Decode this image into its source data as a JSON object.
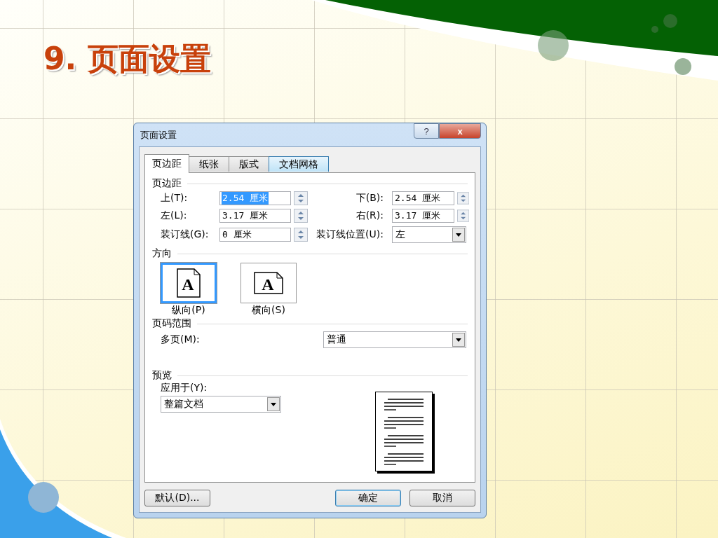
{
  "slide": {
    "title": "9. 页面设置"
  },
  "dialog": {
    "title": "页面设置",
    "help_button": "?",
    "close_button": "x",
    "tabs": [
      {
        "label": "页边距",
        "selected": true,
        "highlighted": false
      },
      {
        "label": "纸张",
        "selected": false,
        "highlighted": false
      },
      {
        "label": "版式",
        "selected": false,
        "highlighted": false
      },
      {
        "label": "文档网格",
        "selected": false,
        "highlighted": true
      }
    ],
    "margins": {
      "heading": "页边距",
      "fields": [
        {
          "kind": "spin",
          "label": "上(T):",
          "value": "2.54 厘米",
          "text_selected": true
        },
        {
          "kind": "spin",
          "label": "下(B):",
          "value": "2.54 厘米",
          "text_selected": false
        },
        {
          "kind": "spin",
          "label": "左(L):",
          "value": "3.17 厘米",
          "text_selected": false
        },
        {
          "kind": "spin",
          "label": "右(R):",
          "value": "3.17 厘米",
          "text_selected": false
        },
        {
          "kind": "spin",
          "label": "装订线(G):",
          "value": "0 厘米",
          "text_selected": false
        },
        {
          "kind": "dropdown",
          "label": "装订线位置(U):",
          "value": "左"
        }
      ]
    },
    "orientation": {
      "heading": "方向",
      "options": [
        {
          "label": "纵向(P)",
          "kind": "portrait",
          "icon_text": "A",
          "selected": true
        },
        {
          "label": "横向(S)",
          "kind": "landscape",
          "icon_text": "A",
          "selected": false
        }
      ]
    },
    "pages": {
      "heading": "页码范围",
      "label": "多页(M):",
      "value": "普通"
    },
    "preview": {
      "heading": "预览",
      "label": "应用于(Y):",
      "value": "整篇文档"
    },
    "buttons": [
      {
        "label": "默认(D)...",
        "kind": "default"
      },
      {
        "label": "确定",
        "kind": "ok"
      },
      {
        "label": "取消",
        "kind": "cancel"
      }
    ]
  }
}
